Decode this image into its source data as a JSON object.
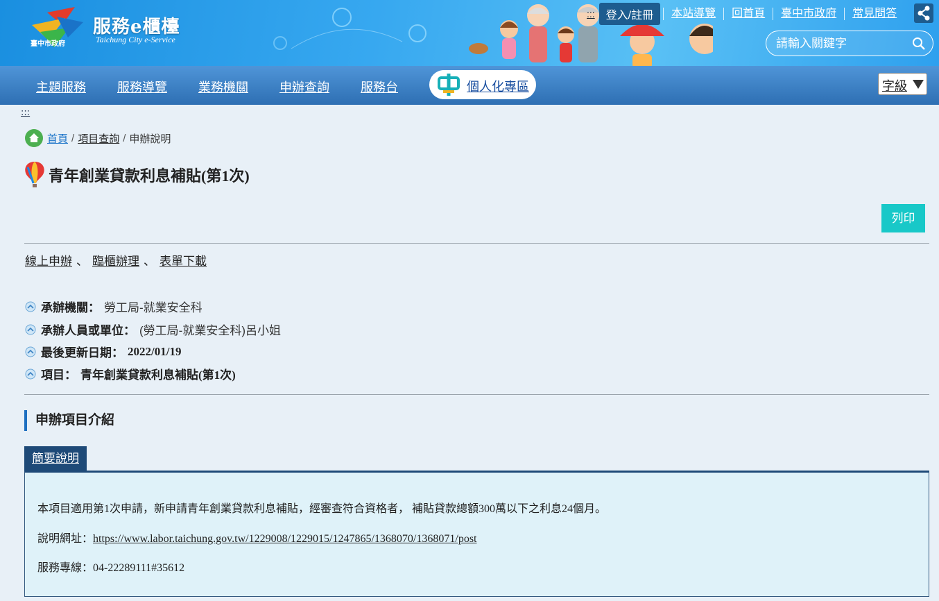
{
  "header": {
    "logo_title": "服務e櫃檯",
    "logo_subtitle": "Taichung City e-Service",
    "logo_city": "臺中市政府",
    "accesskey": ":::",
    "login_label": "登入/註冊",
    "top_links": [
      "本站導覽",
      "回首頁",
      "臺中市政府",
      "常見問答"
    ],
    "search_placeholder": "請輸入關鍵字"
  },
  "main_nav": {
    "items": [
      "主題服務",
      "服務導覽",
      "業務機關",
      "申辦查詢",
      "服務台"
    ],
    "personal_label": "個人化專區",
    "font_size_label": "字級"
  },
  "content": {
    "accesskey": ":::",
    "breadcrumb": [
      "首頁",
      "項目查詢",
      "申辦說明"
    ],
    "title": "青年創業貸款利息補貼(第1次)",
    "print_label": "列印",
    "links": [
      "線上申辦",
      "臨櫃辦理",
      "表單下載"
    ],
    "link_sep": "、",
    "info": [
      {
        "label": "承辦機關：",
        "value": "勞工局-就業安全科"
      },
      {
        "label": "承辦人員或單位：",
        "value": "(勞工局-就業安全科)呂小姐"
      },
      {
        "label": "最後更新日期：",
        "value": "2022/01/19"
      },
      {
        "label": "項目：",
        "value": "青年創業貸款利息補貼(第1次)"
      }
    ],
    "section_title": "申辦項目介紹",
    "tab_label": "簡要說明",
    "description": "本項目適用第1次申請，新申請青年創業貸款利息補貼，經審查符合資格者， 補貼貸款總額300萬以下之利息24個月。",
    "url_label": "說明網址：",
    "url": "https://www.labor.taichung.gov.tw/1229008/1229015/1247865/1368070/1368071/post",
    "hotline_label": "服務專線：",
    "hotline": "04-22289111#35612"
  }
}
